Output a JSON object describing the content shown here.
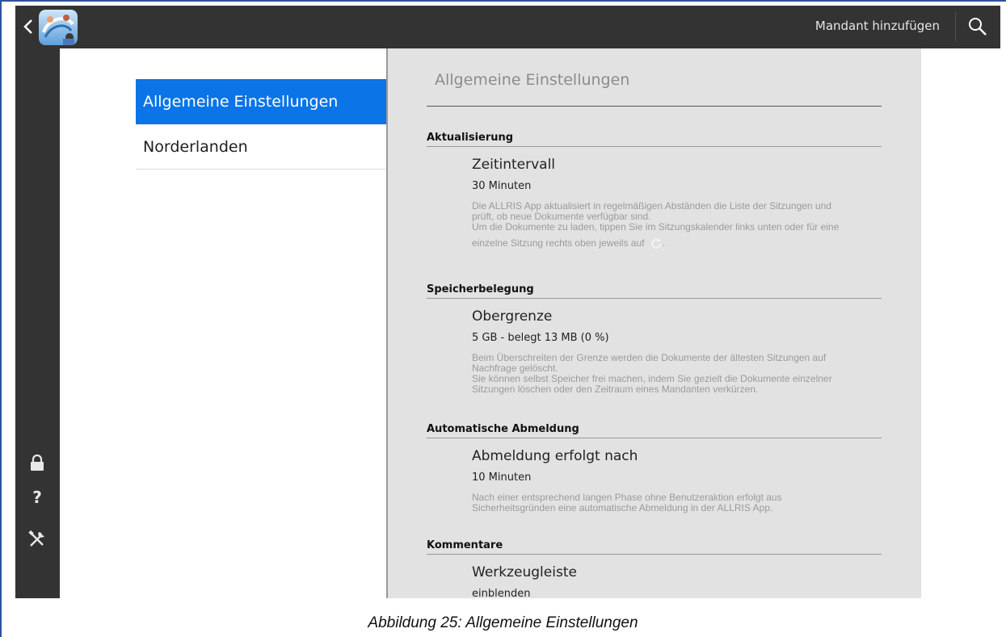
{
  "topbar": {
    "add_client_label": "Mandant hinzufügen",
    "back_icon": "chevron-left-icon",
    "logo_icon": "allris-app-logo",
    "search_icon": "search-icon"
  },
  "rail": {
    "lock_icon": "lock-icon",
    "help_label": "?",
    "tools_icon": "tools-icon"
  },
  "nav": {
    "items": [
      {
        "label": "Allgemeine Einstellungen",
        "active": true
      },
      {
        "label": "Norderlanden",
        "active": false
      }
    ]
  },
  "panel": {
    "title": "Allgemeine Einstellungen",
    "sections": [
      {
        "heading": "Aktualisierung",
        "setting_name": "Zeitintervall",
        "setting_value": "30 Minuten",
        "desc_lines": [
          "Die ALLRIS App aktualisiert in regelmäßigen Abständen die Liste der Sitzungen und",
          "prüft, ob neue Dokumente verfügbar sind.",
          "Um die Dokumente zu laden, tippen Sie im Sitzungskalender links unten oder für eine",
          "einzelne Sitzung rechts oben jeweils auf",
          "."
        ]
      },
      {
        "heading": "Speicherbelegung",
        "setting_name": "Obergrenze",
        "setting_value": "5 GB - belegt 13 MB (0 %)",
        "desc_lines": [
          "Beim Überschreiten der Grenze werden die Dokumente der ältesten Sitzungen auf",
          "Nachfrage gelöscht.",
          "Sie können selbst Speicher frei machen, indem Sie gezielt die Dokumente einzelner",
          "Sitzungen löschen oder den Zeitraum eines Mandanten verkürzen."
        ]
      },
      {
        "heading": "Automatische Abmeldung",
        "setting_name": "Abmeldung erfolgt nach",
        "setting_value": "10 Minuten",
        "desc_lines": [
          "Nach einer entsprechend langen Phase ohne Benutzeraktion erfolgt aus",
          "Sicherheitsgründen eine automatische Abmeldung in der ALLRIS App."
        ]
      },
      {
        "heading": "Kommentare",
        "setting_name": "Werkzeugleiste",
        "setting_value": "einblenden"
      }
    ]
  },
  "caption": "Abbildung 25: Allgemeine Einstellungen",
  "colors": {
    "topbar": "#333333",
    "active_nav": "#0b74e6",
    "panel_bg": "#e2e2e2",
    "frame": "#2c5596"
  }
}
